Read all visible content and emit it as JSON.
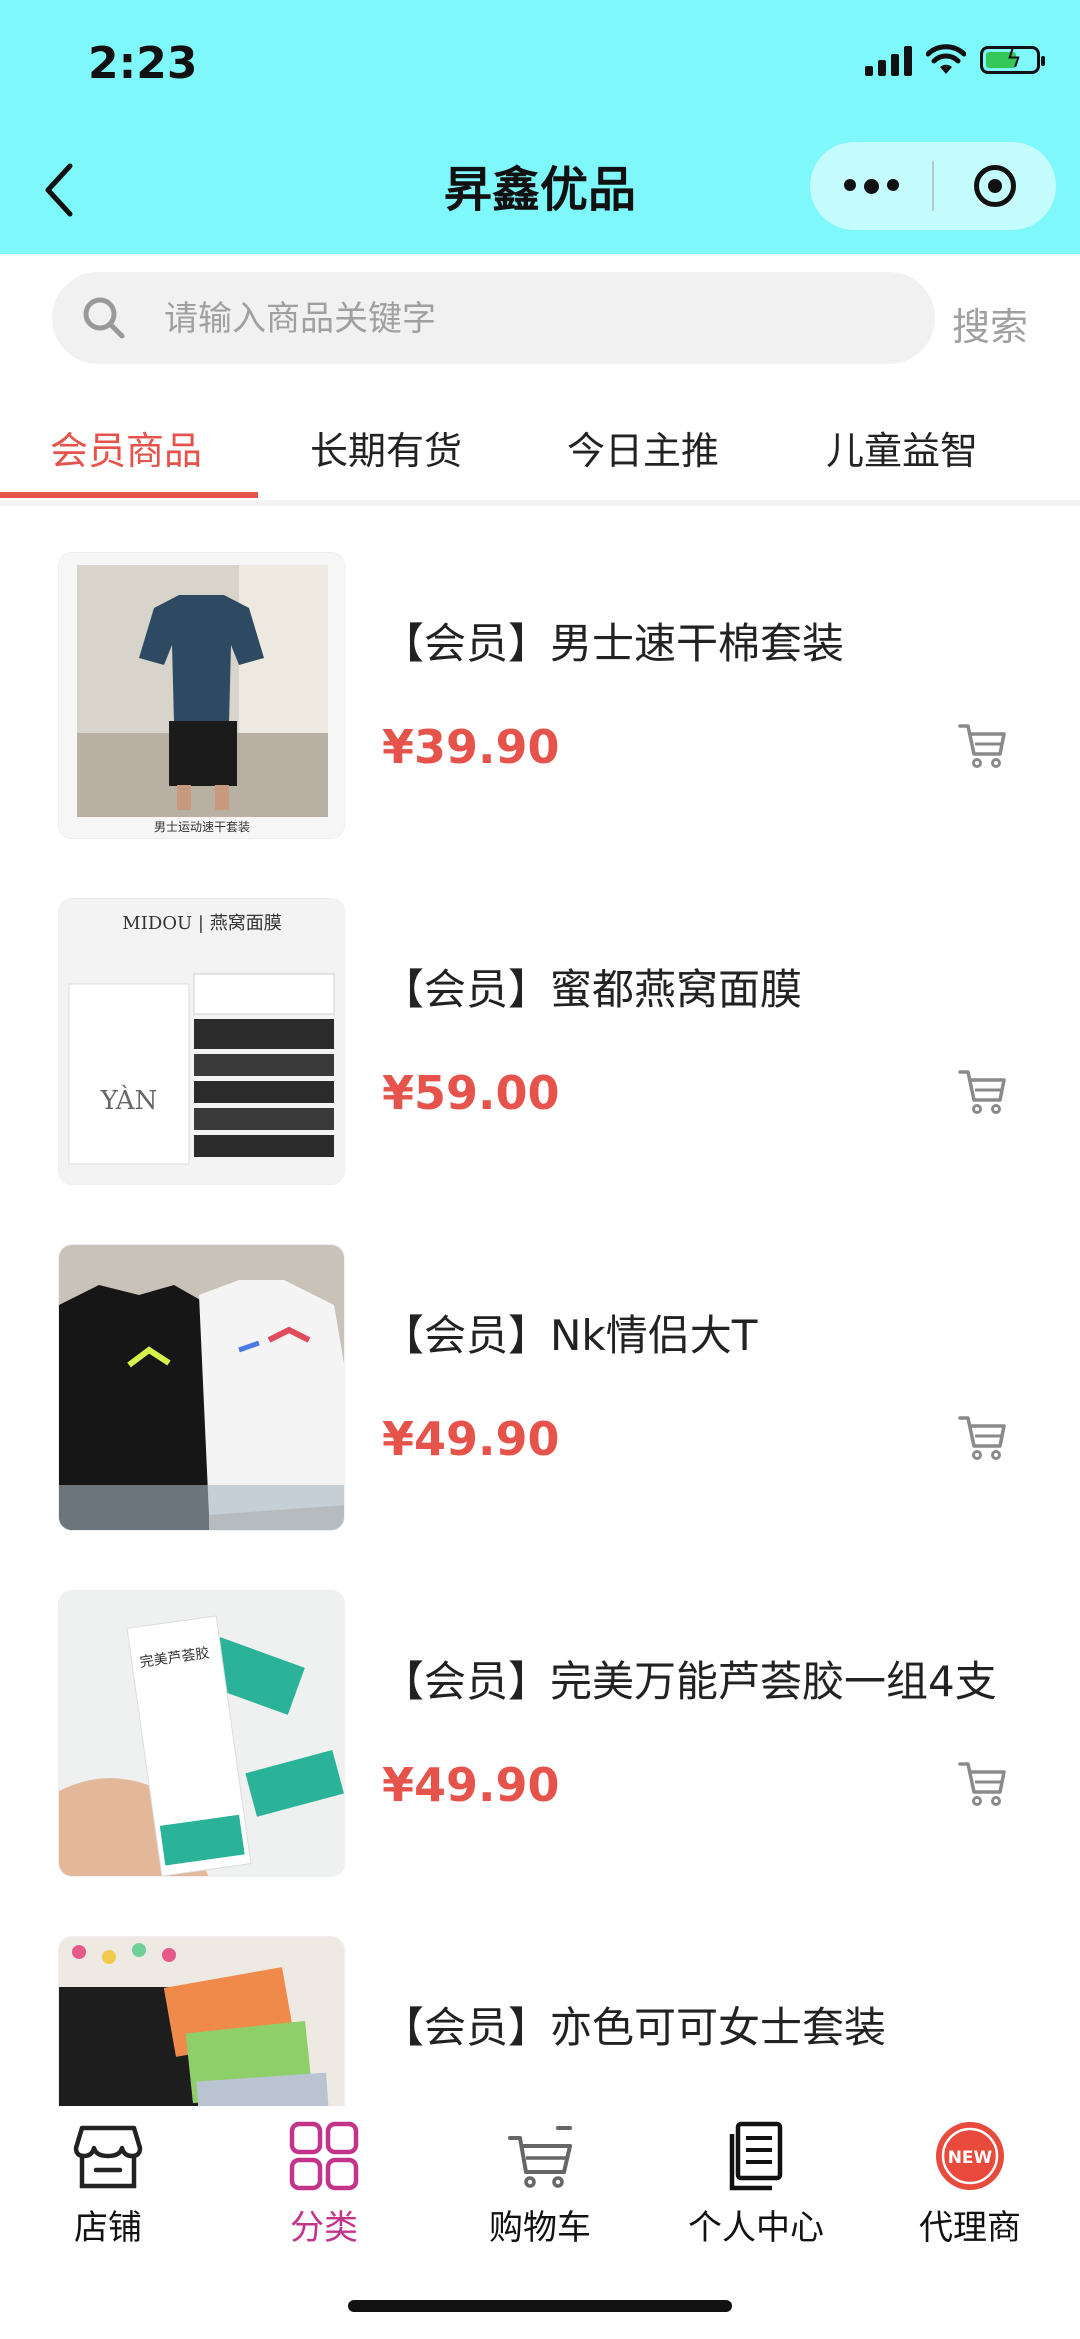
{
  "status_bar": {
    "time": "2:23"
  },
  "header": {
    "title": "昇鑫优品"
  },
  "search": {
    "placeholder": "请输入商品关键字",
    "button_label": "搜索"
  },
  "tabs": [
    {
      "label": "会员商品",
      "active": true
    },
    {
      "label": "长期有货",
      "active": false
    },
    {
      "label": "今日主推",
      "active": false
    },
    {
      "label": "儿童益智",
      "active": false
    }
  ],
  "products": [
    {
      "title": "【会员】男士速干棉套装",
      "price": "¥39.90",
      "image_caption": "男士运动速干套装"
    },
    {
      "title": "【会员】蜜都燕窝面膜",
      "price": "¥59.00",
      "image_caption": "MIDOU | 燕窝面膜"
    },
    {
      "title": "【会员】Nk情侣大T",
      "price": "¥49.90",
      "image_caption": ""
    },
    {
      "title": "【会员】完美万能芦荟胶一组4支",
      "price": "¥49.90",
      "image_caption": "完美芦荟胶"
    },
    {
      "title": "【会员】亦色可可女士套装",
      "price": "",
      "image_caption": ""
    }
  ],
  "bottom_nav": [
    {
      "label": "店铺",
      "icon": "store-icon",
      "active": false
    },
    {
      "label": "分类",
      "icon": "grid-icon",
      "active": true
    },
    {
      "label": "购物车",
      "icon": "cart-icon",
      "active": false
    },
    {
      "label": "个人中心",
      "icon": "document-icon",
      "active": false
    },
    {
      "label": "代理商",
      "icon": "new-badge-icon",
      "active": false,
      "badge": "NEW"
    }
  ],
  "colors": {
    "header_bg": "#7ef8fb",
    "accent_red": "#e5534b",
    "active_nav": "#c2338a"
  }
}
